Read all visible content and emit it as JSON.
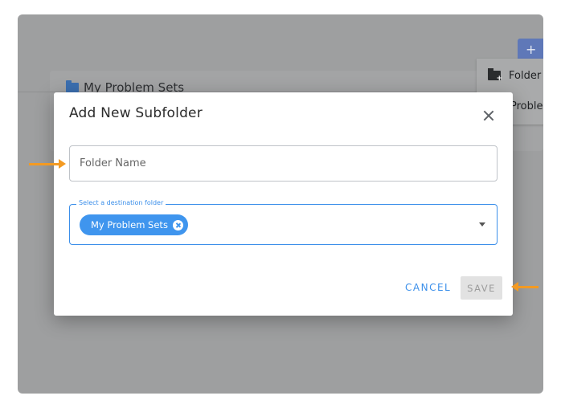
{
  "background": {
    "page_title": "My Problem Sets",
    "add_button_label": "+",
    "menu": {
      "items": [
        {
          "label": "Folder",
          "icon": "create-folder-icon"
        },
        {
          "label": "Probler",
          "icon": "none"
        }
      ]
    }
  },
  "dialog": {
    "title": "Add New Subfolder",
    "close_icon": "close-icon",
    "folder_name": {
      "value": "",
      "placeholder": "Folder Name"
    },
    "destination": {
      "label": "Select a destination folder",
      "selected_chip": "My Problem Sets"
    },
    "cancel_label": "CANCEL",
    "save_label": "SAVE"
  },
  "colors": {
    "accent": "#3b8fea",
    "chip": "#3f95ee",
    "annotation_arrow": "#f39a22",
    "overlay": "#9e9fa0"
  }
}
